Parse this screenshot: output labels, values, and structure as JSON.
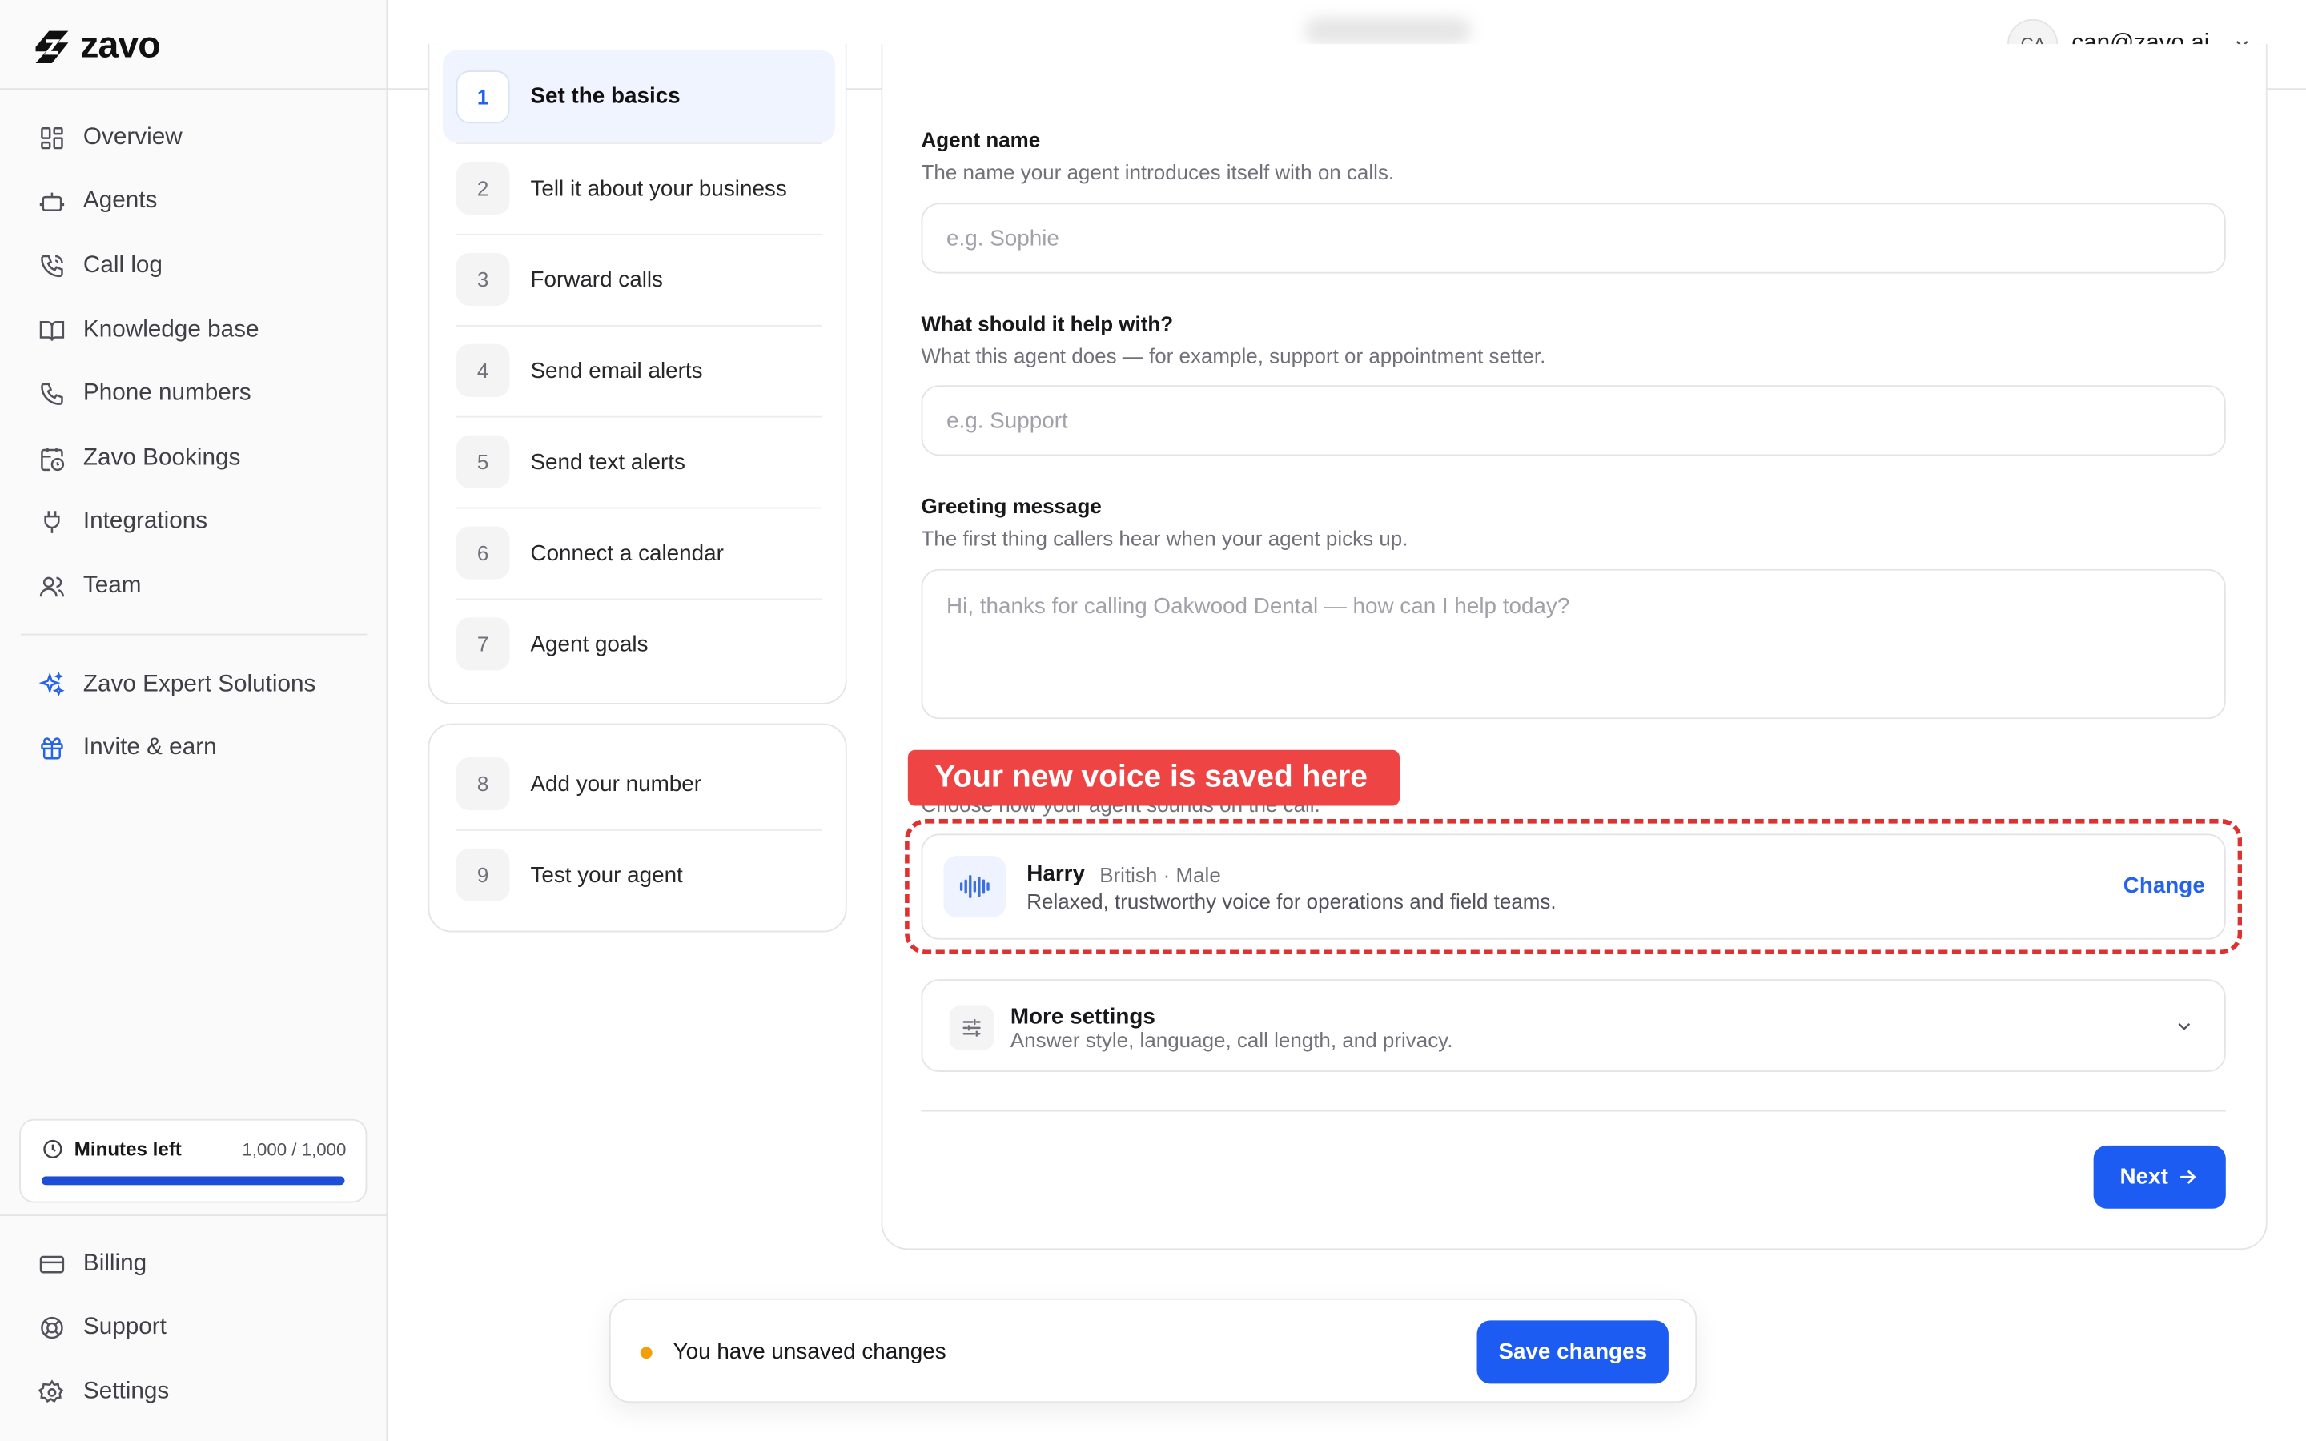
{
  "app": {
    "name": "zavo"
  },
  "sidebar": {
    "items": [
      {
        "label": "Overview",
        "icon": "grid-icon"
      },
      {
        "label": "Agents",
        "icon": "robot-icon"
      },
      {
        "label": "Call log",
        "icon": "phone-call-icon"
      },
      {
        "label": "Knowledge base",
        "icon": "book-icon"
      },
      {
        "label": "Phone numbers",
        "icon": "phone-icon"
      },
      {
        "label": "Zavo Bookings",
        "icon": "calendar-clock-icon"
      },
      {
        "label": "Integrations",
        "icon": "plug-icon"
      },
      {
        "label": "Team",
        "icon": "users-icon"
      }
    ],
    "extras": [
      {
        "label": "Zavo Expert Solutions",
        "icon": "sparkles-icon"
      },
      {
        "label": "Invite & earn",
        "icon": "gift-icon"
      }
    ],
    "minutes": {
      "label": "Minutes left",
      "value": "1,000 / 1,000",
      "fraction": 1.0
    },
    "bottom": [
      {
        "label": "Billing",
        "icon": "credit-card-icon"
      },
      {
        "label": "Support",
        "icon": "lifebuoy-icon"
      },
      {
        "label": "Settings",
        "icon": "gear-icon"
      }
    ]
  },
  "header": {
    "avatar_initials": "CA",
    "email": "can@zavo.ai"
  },
  "steps": [
    {
      "num": "1",
      "label": "Set the basics",
      "active": true
    },
    {
      "num": "2",
      "label": "Tell it about your business"
    },
    {
      "num": "3",
      "label": "Forward calls"
    },
    {
      "num": "4",
      "label": "Send email alerts"
    },
    {
      "num": "5",
      "label": "Send text alerts"
    },
    {
      "num": "6",
      "label": "Connect a calendar"
    },
    {
      "num": "7",
      "label": "Agent goals"
    },
    {
      "num": "8",
      "label": "Add your number"
    },
    {
      "num": "9",
      "label": "Test your agent"
    }
  ],
  "form": {
    "agent_name": {
      "label": "Agent name",
      "help": "The name your agent introduces itself with on calls.",
      "placeholder": "e.g. Sophie",
      "value": ""
    },
    "purpose": {
      "label": "What should it help with?",
      "help": "What this agent does — for example, support or appointment setter.",
      "placeholder": "e.g. Support",
      "value": ""
    },
    "greeting": {
      "label": "Greeting message",
      "help": "The first thing callers hear when your agent picks up.",
      "placeholder": "Hi, thanks for calling Oakwood Dental — how can I help today?"
    },
    "voice": {
      "partial_help": "Choose how your agent sounds on the call.",
      "name": "Harry",
      "meta": "British · Male",
      "description": "Relaxed, trustworthy voice for operations and field teams.",
      "change_label": "Change"
    },
    "more": {
      "title": "More settings",
      "subtitle": "Answer style, language, call length, and privacy."
    },
    "next_label": "Next"
  },
  "callout": {
    "text": "Your new voice is saved here",
    "color": "#ef4444"
  },
  "unsaved": {
    "text": "You have unsaved changes",
    "save_label": "Save changes"
  },
  "colors": {
    "accent": "#1d5cf2",
    "callout": "#ef4444",
    "warning_dot": "#f59e0b"
  }
}
